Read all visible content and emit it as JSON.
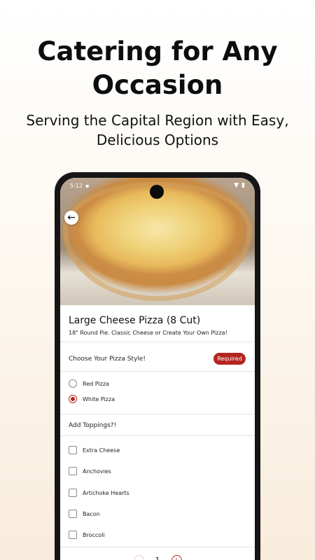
{
  "promo": {
    "headline_line1": "Catering for Any",
    "headline_line2": "Occasion",
    "subline_line1": "Serving the Capital Region with Easy,",
    "subline_line2": "Delicious Options"
  },
  "status_bar": {
    "time": "5:12",
    "icons": [
      "wifi-icon",
      "battery-icon"
    ]
  },
  "item": {
    "title": "Large Cheese Pizza (8 Cut)",
    "description": "18\" Round Pie. Classic Cheese or Create Your Own Pizza!"
  },
  "pizza_style": {
    "label": "Choose Your Pizza Style!",
    "badge": "Required",
    "options": [
      {
        "label": "Red Pizza",
        "selected": false
      },
      {
        "label": "White Pizza",
        "selected": true
      }
    ]
  },
  "toppings": {
    "label": "Add Toppings?!",
    "options": [
      {
        "label": "Extra Cheese",
        "checked": false
      },
      {
        "label": "Anchovies",
        "checked": false
      },
      {
        "label": "Artichoke Hearts",
        "checked": false
      },
      {
        "label": "Bacon",
        "checked": false
      },
      {
        "label": "Broccoli",
        "checked": false
      }
    ]
  },
  "quantity": {
    "value": "1",
    "minus": "−",
    "plus": "+"
  },
  "colors": {
    "accent": "#b3261e",
    "background_top": "#ffffff",
    "background_bottom": "#f8ecdc"
  }
}
